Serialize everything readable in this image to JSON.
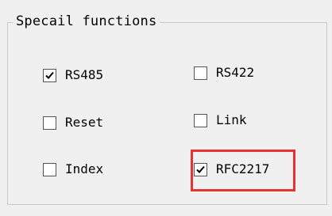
{
  "group": {
    "title": "Specail functions"
  },
  "checkboxes": [
    {
      "label": "RS485",
      "checked": true
    },
    {
      "label": "RS422",
      "checked": false
    },
    {
      "label": "Reset",
      "checked": false
    },
    {
      "label": "Link",
      "checked": false
    },
    {
      "label": "Index",
      "checked": false
    },
    {
      "label": "RFC2217",
      "checked": true
    }
  ],
  "colors": {
    "highlight": "#e53333",
    "background": "#f0f0f0"
  }
}
